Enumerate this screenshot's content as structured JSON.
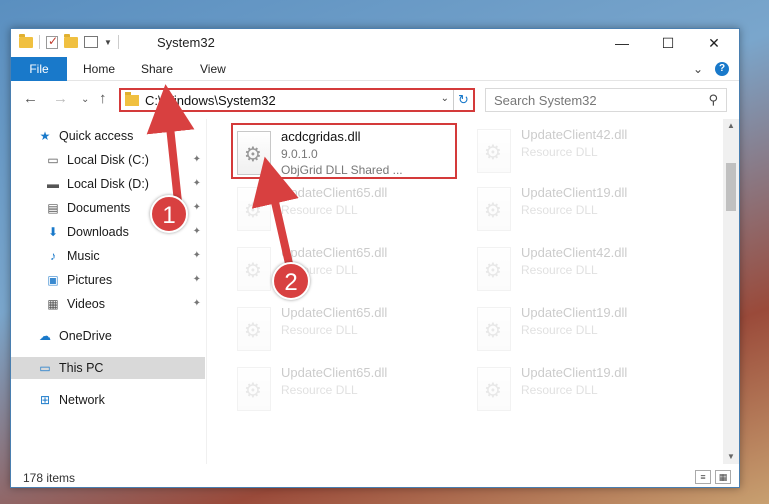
{
  "window": {
    "title": "System32",
    "controls": {
      "minimize": "—",
      "maximize": "☐",
      "close": "✕"
    }
  },
  "ribbon": {
    "tabs": [
      "File",
      "Home",
      "Share",
      "View"
    ],
    "expand": "⌄",
    "help": "?"
  },
  "address": {
    "path": "C:\\Windows\\System32",
    "dropdown": "⌄",
    "refresh": "↻"
  },
  "search": {
    "placeholder": "Search System32",
    "icon": "⚲"
  },
  "nav_buttons": {
    "back": "←",
    "forward": "→",
    "recent": "⌄",
    "up": "↑"
  },
  "sidebar": {
    "items": [
      {
        "label": "Quick access",
        "icon": "★",
        "pinned": false
      },
      {
        "label": "Local Disk (C:)",
        "icon": "▭",
        "pinned": true
      },
      {
        "label": "Local Disk (D:)",
        "icon": "▬",
        "pinned": true
      },
      {
        "label": "Documents",
        "icon": "▤",
        "pinned": true
      },
      {
        "label": "Downloads",
        "icon": "⬇",
        "pinned": true
      },
      {
        "label": "Music",
        "icon": "♪",
        "pinned": true
      },
      {
        "label": "Pictures",
        "icon": "▣",
        "pinned": true
      },
      {
        "label": "Videos",
        "icon": "▦",
        "pinned": true
      },
      {
        "label": "OneDrive",
        "icon": "☁",
        "pinned": false
      },
      {
        "label": "This PC",
        "icon": "▭",
        "pinned": false
      },
      {
        "label": "Network",
        "icon": "⊞",
        "pinned": false
      }
    ],
    "pin_glyph": "📌"
  },
  "files": {
    "featured": {
      "name": "acdcgridas.dll",
      "version": "9.0.1.0",
      "description": "ObjGrid DLL Shared ..."
    },
    "background_left": [
      {
        "name": "UpdateClient65.dll",
        "desc": "Resource DLL"
      },
      {
        "name": "UpdateClient65.dll",
        "desc": "Resource DLL"
      },
      {
        "name": "UpdateClient65.dll",
        "desc": "Resource DLL"
      },
      {
        "name": "UpdateClient65.dll",
        "desc": "Resource DLL"
      }
    ],
    "background_right": [
      {
        "name": "UpdateClient42.dll",
        "desc": "Resource DLL"
      },
      {
        "name": "UpdateClient19.dll",
        "desc": "Resource DLL"
      },
      {
        "name": "UpdateClient42.dll",
        "desc": "Resource DLL"
      },
      {
        "name": "UpdateClient19.dll",
        "desc": "Resource DLL"
      },
      {
        "name": "UpdateClient19.dll",
        "desc": "Resource DLL"
      }
    ]
  },
  "status": {
    "count": "178 items",
    "view_details": "≡",
    "view_icons": "▦"
  },
  "annotations": {
    "step1": "1",
    "step2": "2"
  },
  "colors": {
    "accent": "#1979ca",
    "highlight_red": "#d43a3a",
    "badge_red": "#d84040"
  }
}
